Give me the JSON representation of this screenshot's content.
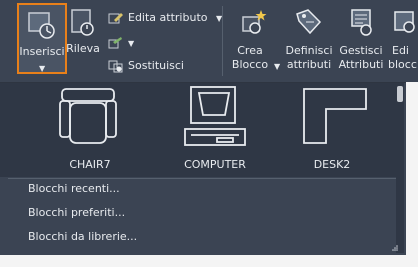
{
  "ribbon": {
    "insert": "Inserisci",
    "rileva": "Rileva",
    "edita_attributo": "Edita attributo",
    "sostituisci": "Sostituisci",
    "crea_blocco": [
      "Crea",
      "Blocco"
    ],
    "definisci_attributi": [
      "Definisci",
      "attributi"
    ],
    "gestisci_attributi": [
      "Gestisci",
      "Attributi"
    ],
    "editor_blocchi": [
      "Edi",
      "blocc"
    ]
  },
  "gallery": {
    "items": [
      {
        "name": "CHAIR7",
        "icon": "chair-icon"
      },
      {
        "name": "COMPUTER",
        "icon": "computer-icon"
      },
      {
        "name": "DESK2",
        "icon": "desk-icon"
      }
    ]
  },
  "menu": [
    "Blocchi recenti...",
    "Blocchi preferiti...",
    "Blocchi da librerie..."
  ],
  "colors": {
    "ribbon_bg": "#3b4453",
    "gallery_bg": "#2f3745",
    "highlight_border": "#e8801a",
    "text": "#e8ebef"
  }
}
